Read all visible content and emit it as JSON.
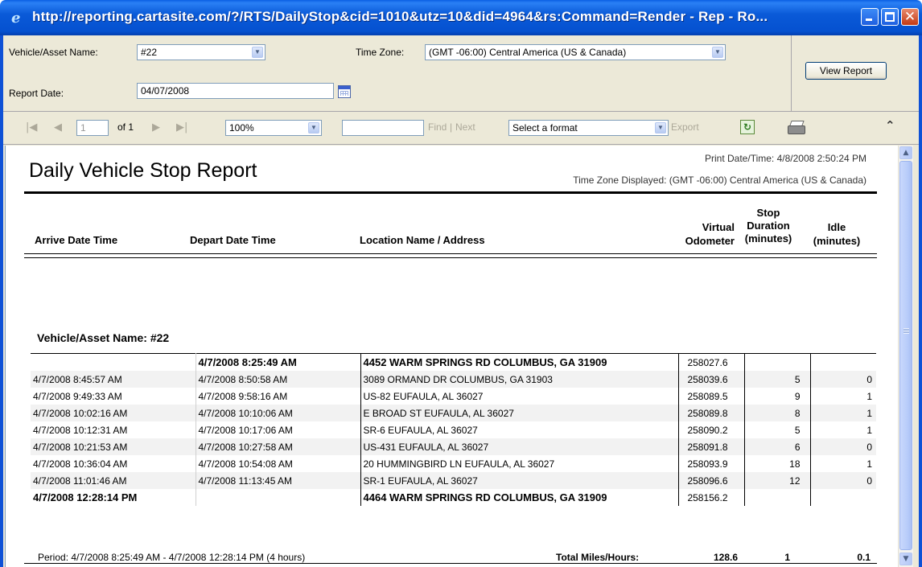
{
  "window": {
    "title": "http://reporting.cartasite.com/?/RTS/DailyStop&cid=1010&utz=10&did=4964&rs:Command=Render - Rep - Ro..."
  },
  "params": {
    "vehicle_label": "Vehicle/Asset Name:",
    "vehicle_value": "#22",
    "timezone_label": "Time Zone:",
    "timezone_value": "(GMT -06:00) Central America (US & Canada)",
    "report_date_label": "Report Date:",
    "report_date_value": "04/07/2008",
    "view_report_label": "View Report"
  },
  "toolbar": {
    "page_value": "1",
    "page_of": "of 1",
    "zoom_value": "100%",
    "find_label": "Find",
    "next_label": "Next",
    "find_separator": "|",
    "format_value": "Select a format",
    "export_label": "Export"
  },
  "report": {
    "title": "Daily Vehicle Stop Report",
    "print_date": "Print Date/Time: 4/8/2008 2:50:24 PM",
    "timezone_displayed": "Time Zone Displayed: (GMT -06:00) Central America (US & Canada)",
    "headers": {
      "arrive": "Arrive Date Time",
      "depart": "Depart Date Time",
      "location": "Location Name / Address",
      "odo_1": "Virtual",
      "odo_2": "Odometer",
      "stop_1": "Stop",
      "stop_2": "Duration",
      "stop_3": "(minutes)",
      "idle_1": "Idle",
      "idle_2": "(minutes)"
    },
    "group_label": "Vehicle/Asset Name: #22",
    "rows": [
      {
        "arrive": "",
        "depart": "4/7/2008 8:25:49 AM",
        "location": "4452 WARM SPRINGS RD COLUMBUS, GA 31909",
        "odometer": "258027.6",
        "stop": "",
        "idle": ""
      },
      {
        "arrive": "4/7/2008 8:45:57 AM",
        "depart": "4/7/2008 8:50:58 AM",
        "location": "3089 ORMAND DR COLUMBUS, GA 31903",
        "odometer": "258039.6",
        "stop": "5",
        "idle": "0"
      },
      {
        "arrive": "4/7/2008 9:49:33 AM",
        "depart": "4/7/2008 9:58:16 AM",
        "location": "US-82 EUFAULA, AL 36027",
        "odometer": "258089.5",
        "stop": "9",
        "idle": "1"
      },
      {
        "arrive": "4/7/2008 10:02:16 AM",
        "depart": "4/7/2008 10:10:06 AM",
        "location": "E BROAD ST EUFAULA, AL 36027",
        "odometer": "258089.8",
        "stop": "8",
        "idle": "1"
      },
      {
        "arrive": "4/7/2008 10:12:31 AM",
        "depart": "4/7/2008 10:17:06 AM",
        "location": "SR-6 EUFAULA, AL 36027",
        "odometer": "258090.2",
        "stop": "5",
        "idle": "1"
      },
      {
        "arrive": "4/7/2008 10:21:53 AM",
        "depart": "4/7/2008 10:27:58 AM",
        "location": "US-431 EUFAULA, AL 36027",
        "odometer": "258091.8",
        "stop": "6",
        "idle": "0"
      },
      {
        "arrive": "4/7/2008 10:36:04 AM",
        "depart": "4/7/2008 10:54:08 AM",
        "location": "20 HUMMINGBIRD LN EUFAULA, AL 36027",
        "odometer": "258093.9",
        "stop": "18",
        "idle": "1"
      },
      {
        "arrive": "4/7/2008 11:01:46 AM",
        "depart": "4/7/2008 11:13:45 AM",
        "location": "SR-1 EUFAULA, AL 36027",
        "odometer": "258096.6",
        "stop": "12",
        "idle": "0"
      },
      {
        "arrive": "4/7/2008 12:28:14 PM",
        "depart": "",
        "location": "4464 WARM SPRINGS RD COLUMBUS, GA 31909",
        "odometer": "258156.2",
        "stop": "",
        "idle": ""
      }
    ],
    "footer": {
      "period": "Period: 4/7/2008 8:25:49 AM - 4/7/2008 12:28:14 PM (4 hours)",
      "totals_label": "Total Miles/Hours:",
      "total_miles": "128.6",
      "total_stop": "1",
      "total_idle": "0.1"
    }
  },
  "icons": {
    "first_page": "first-page-icon",
    "prev_page": "prev-page-icon",
    "next_page": "next-page-icon",
    "last_page": "last-page-icon",
    "calendar": "calendar-icon",
    "refresh": "refresh-icon",
    "print": "printer-icon",
    "collapse": "double-chevron-up-icon"
  }
}
